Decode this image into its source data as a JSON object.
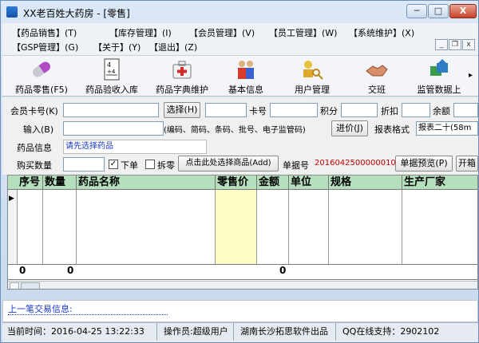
{
  "window": {
    "title": "XX老百姓大药房 - [零售]",
    "controls": {
      "minimize": "─",
      "maximize": "□",
      "close": "X"
    }
  },
  "menu": {
    "items": [
      "【药品销售】(T)",
      "【库存管理】(I)",
      "【会员管理】(V)",
      "【员工管理】(W)",
      "【系统维护】(X)",
      "【GSP管理】(G)",
      "【关于】(Y)",
      "【退出】(Z)"
    ],
    "mdi": {
      "minimize": "_",
      "restore": "❐",
      "close": "x"
    }
  },
  "toolbar": {
    "items": [
      {
        "label": "药品零售(F5)",
        "icon": "pill-icon"
      },
      {
        "label": "药品验收入库",
        "icon": "calculator-icon"
      },
      {
        "label": "药品字典维护",
        "icon": "medical-kit-icon"
      },
      {
        "label": "基本信息",
        "icon": "people-icon"
      },
      {
        "label": "用户管理",
        "icon": "users-key-icon"
      },
      {
        "label": "交班",
        "icon": "handshake-icon"
      },
      {
        "label": "监管数据上",
        "icon": "upload-icon"
      }
    ],
    "more": "▸"
  },
  "form": {
    "member_card_label": "会员卡号(K)",
    "member_card_value": "",
    "select_button": "选择(H)",
    "select_value": "",
    "card_no_label": "卡号",
    "card_no_value": "",
    "points_label": "积分",
    "points_value": "",
    "discount_label": "折扣",
    "discount_value": "",
    "balance_label": "余额",
    "balance_value": "",
    "input_label": "输入(B)",
    "input_value": "",
    "input_hint": "(编码、简码、条码、批号、电子监管码)",
    "restock_button": "进价(J)",
    "report_format_label": "报表格式",
    "report_format_value": "报表二十(58m",
    "drug_info_label": "药品信息",
    "drug_info_value": "请先选择药品",
    "buy_qty_label": "购买数量",
    "buy_qty_value": "",
    "order_checkbox_label": "下单",
    "order_checked": "✓",
    "split_checkbox_label": "拆零",
    "add_button": "点击此处选择商品(Add)",
    "doc_no_label": "单据号",
    "doc_no_value": "2016042500000010",
    "preview_button": "单据预览(P)",
    "open_button": "开箱"
  },
  "table": {
    "headers": [
      "序号",
      "数量",
      "药品名称",
      "零售价",
      "金额",
      "单位",
      "规格",
      "生产厂家"
    ],
    "row_indicator": "▶",
    "footer": {
      "seq": "0",
      "qty": "0",
      "amount": "0"
    }
  },
  "last_transaction": {
    "label": "上一笔交易信息:"
  },
  "status": {
    "current_time": "当前时间：2016-04-25 13:22:33",
    "operator": "操作员:超级用户",
    "company": "湖南长沙拓思软件出品",
    "qq": "QQ在线支持：2902102"
  },
  "colors": {
    "title_bg": "#dbe8f7",
    "grid_header": "#b6e0bd",
    "price_column": "#fefcc5",
    "doc_no_color": "#c00000",
    "drug_info_color": "#1a38c8"
  }
}
